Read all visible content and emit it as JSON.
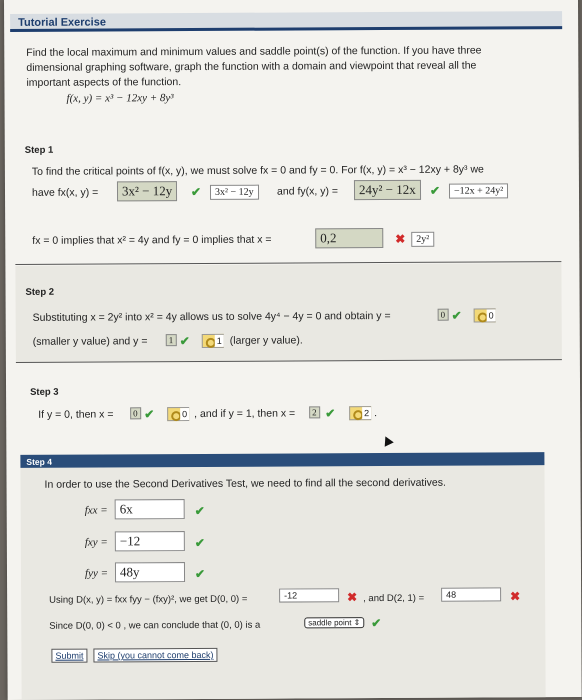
{
  "header": {
    "title": "Tutorial Exercise"
  },
  "problem": {
    "text": "Find the local maximum and minimum values and saddle point(s) of the function. If you have three dimensional graphing software, graph the function with a domain and viewpoint that reveal all the important aspects of the function.",
    "function": "f(x, y) = x³ − 12xy + 8y³"
  },
  "step1": {
    "title": "Step 1",
    "line1": "To find the critical points of f(x, y), we must solve fx = 0 and fy = 0. For f(x, y) = x³ − 12xy + 8y³ we",
    "have_label": "have fx(x, y) =",
    "fx_answer": "3x² − 12y",
    "fx_key": "3x² − 12y",
    "and_label": "and fy(x, y) =",
    "fy_answer": "24y² − 12x",
    "fy_key": "−12x + 24y²",
    "line3": "fx = 0 implies that x² = 4y and fy = 0 implies that x =",
    "x_answer": "0,2",
    "x_key": "2y²"
  },
  "step2": {
    "title": "Step 2",
    "line1a": "Substituting x = 2y² into x² = 4y allows us to solve 4y⁴ − 4y = 0 and obtain y =",
    "y1_answer": "0",
    "y1_key": "0",
    "line2a": "(smaller y value) and y =",
    "y2_answer": "1",
    "y2_key": "1",
    "line2b": "(larger y value)."
  },
  "step3": {
    "title": "Step 3",
    "line_a": "If y = 0, then x =",
    "x1_answer": "0",
    "x1_key": "0",
    "line_b": ", and if y = 1, then x =",
    "x2_answer": "2",
    "x2_key": "2"
  },
  "step4": {
    "title": "Step 4",
    "intro": "In order to use the Second Derivatives Test, we need to find all the second derivatives.",
    "fxx_label": "fxx =",
    "fxx_answer": "6x",
    "fxy_label": "fxy =",
    "fxy_answer": "−12",
    "fyy_label": "fyy =",
    "fyy_answer": "48y",
    "using_label": "Using D(x, y) = fxx fyy − (fxy)², we get D(0, 0) =",
    "d00_answer": "-12",
    "d21_label": ", and D(2, 1) =",
    "d21_answer": "48",
    "since_label": "Since D(0, 0) < 0 , we can conclude that (0, 0) is a",
    "since_select": "saddle point",
    "submit": "Submit",
    "skip": "Skip (you cannot come back)"
  },
  "colors": {
    "header_bar": "#1e3e6e",
    "check": "#3a9a3a",
    "cross": "#d12a2a"
  }
}
